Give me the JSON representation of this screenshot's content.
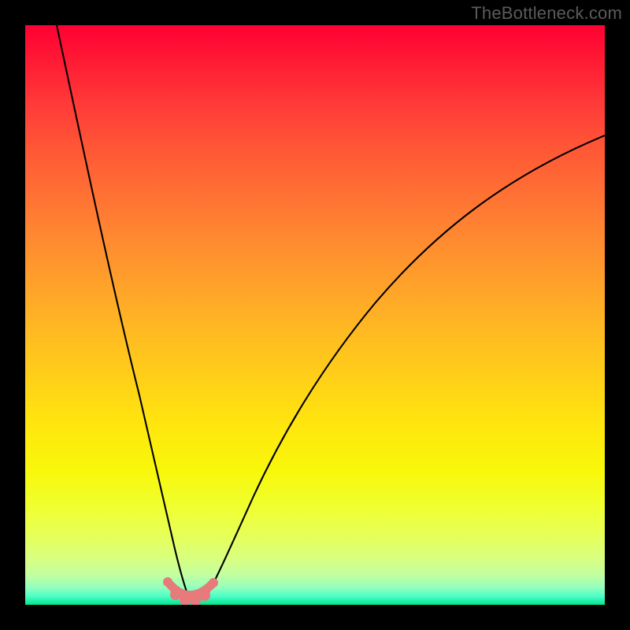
{
  "watermark": "TheBottleneck.com",
  "chart_data": {
    "type": "line",
    "title": "",
    "xlabel": "",
    "ylabel": "",
    "xlim": [
      0,
      100
    ],
    "ylim": [
      0,
      100
    ],
    "grid": false,
    "legend": false,
    "note": "Axes are unlabeled in the source image; values below are normalized 0–100 percent of the plot area (x left→right, y bottom→top). Curve values are read from pixel positions.",
    "series": [
      {
        "name": "left-branch",
        "color": "#000000",
        "x": [
          5.4,
          8.1,
          10.8,
          13.5,
          16.2,
          18.9,
          21.6,
          23.3,
          24.6,
          26.0
        ],
        "y": [
          100,
          82,
          65,
          49.5,
          35.5,
          23.5,
          13.2,
          7.5,
          4.0,
          1.5
        ]
      },
      {
        "name": "right-branch",
        "color": "#000000",
        "x": [
          32.5,
          35.0,
          38.0,
          42.0,
          47.0,
          53.0,
          60.0,
          68.0,
          77.0,
          87.0,
          100.0
        ],
        "y": [
          1.5,
          6.0,
          13.0,
          22.5,
          32.5,
          42.0,
          51.0,
          59.5,
          67.0,
          73.8,
          81.0
        ]
      },
      {
        "name": "valley-dots",
        "type": "scatter",
        "color": "#e77a7a",
        "x": [
          24.6,
          26.0,
          27.5,
          29.3,
          31.0,
          32.5
        ],
        "y": [
          4.0,
          1.8,
          0.9,
          0.9,
          1.8,
          4.0
        ]
      }
    ],
    "gradient_stops": [
      {
        "pos": 0.0,
        "color": "#ff0033"
      },
      {
        "pos": 0.29,
        "color": "#ff7034"
      },
      {
        "pos": 0.61,
        "color": "#ffd018"
      },
      {
        "pos": 0.83,
        "color": "#f0ff30"
      },
      {
        "pos": 0.95,
        "color": "#c0ffa3"
      },
      {
        "pos": 1.0,
        "color": "#00e58e"
      }
    ]
  }
}
